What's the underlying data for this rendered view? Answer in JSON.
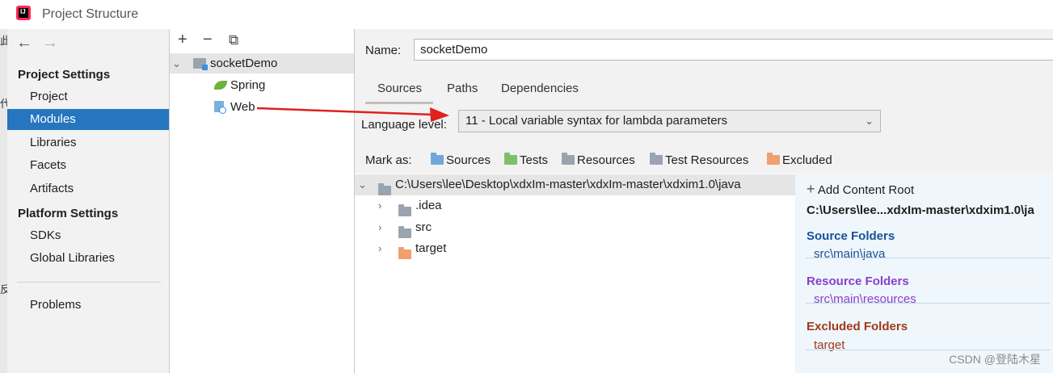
{
  "window": {
    "title": "Project Structure"
  },
  "nav": {
    "back": "←",
    "forward": "→",
    "project_settings": "Project Settings",
    "project_items": [
      "Project",
      "Modules",
      "Libraries",
      "Facets",
      "Artifacts"
    ],
    "platform_settings": "Platform Settings",
    "platform_items": [
      "SDKs",
      "Global Libraries"
    ],
    "problems": "Problems"
  },
  "modules": {
    "add": "+",
    "remove": "−",
    "copy": "⧉",
    "root": "socketDemo",
    "children": [
      "Spring",
      "Web"
    ]
  },
  "module": {
    "name_label": "Name:",
    "name_value": "socketDemo",
    "tabs": [
      "Sources",
      "Paths",
      "Dependencies"
    ],
    "language_label": "Language level:",
    "language_value": "11 - Local variable syntax for lambda parameters",
    "mark_as": "Mark as:",
    "mark_items": [
      "Sources",
      "Tests",
      "Resources",
      "Test Resources",
      "Excluded"
    ],
    "tree_root": "C:\\Users\\lee\\Desktop\\xdxIm-master\\xdxIm-master\\xdxim1.0\\java",
    "tree_children": [
      ".idea",
      "src",
      "target"
    ]
  },
  "content_root": {
    "add_label": "Add Content Root",
    "path": "C:\\Users\\lee...xdxIm-master\\xdxim1.0\\ja",
    "source_title": "Source Folders",
    "source_path": "src\\main\\java",
    "resource_title": "Resource Folders",
    "resource_path": "src\\main\\resources",
    "excluded_title": "Excluded Folders",
    "excluded_path": "target"
  },
  "watermark": "CSDN @登陆木星",
  "colors": {
    "selection": "#2675bf",
    "sources": "#6ea8d8",
    "tests": "#7fbf6a",
    "excluded": "#f0a070",
    "source_title": "#1a4f96",
    "resource_title": "#8a3fc8",
    "excluded_title": "#a03a1a",
    "arrow": "#e02020"
  }
}
